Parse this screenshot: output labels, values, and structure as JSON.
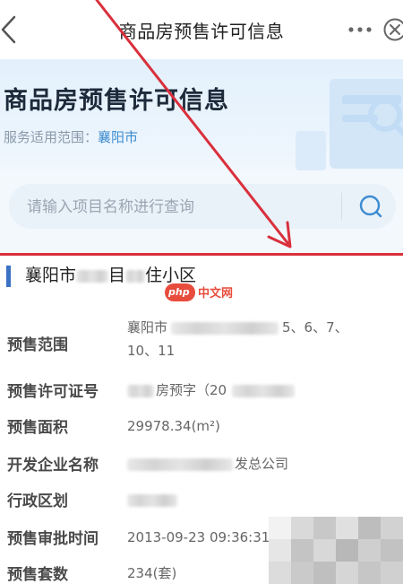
{
  "navbar": {
    "title": "商品房预售许可信息"
  },
  "banner": {
    "title": "商品房预售许可信息",
    "scope_label": "服务适用范围：",
    "scope_city": "襄阳市"
  },
  "search": {
    "placeholder": "请输入项目名称进行查询"
  },
  "card": {
    "title_prefix": "襄阳市",
    "title_middle": "目",
    "title_suffix": "住小区",
    "rows": [
      {
        "label": "预售范围",
        "value_prefix": "襄阳市",
        "value_suffix": "5、6、7、",
        "value_line2": "10、11"
      },
      {
        "label": "预售许可证号",
        "value_prefix": "房预字（20",
        "value_suffix": ""
      },
      {
        "label": "预售面积",
        "value": "29978.34(m²)"
      },
      {
        "label": "开发企业名称",
        "value_suffix": "发总公司"
      },
      {
        "label": "行政区划",
        "value": ""
      },
      {
        "label": "预售审批时间",
        "value": "2013-09-23 09:36:31"
      },
      {
        "label": "预售套数",
        "value": "234(套)"
      }
    ]
  },
  "watermark": {
    "logo": "php",
    "text": "中文网"
  },
  "icons": {
    "back": "chevron-left-icon",
    "more": "more-dots-icon",
    "close": "close-circle-icon",
    "search": "search-icon"
  },
  "colors": {
    "accent_blue": "#3a72c4",
    "link_blue": "#3b8bd0",
    "annotation_red": "#d9303c",
    "banner_bg": "#e3f0fb"
  }
}
